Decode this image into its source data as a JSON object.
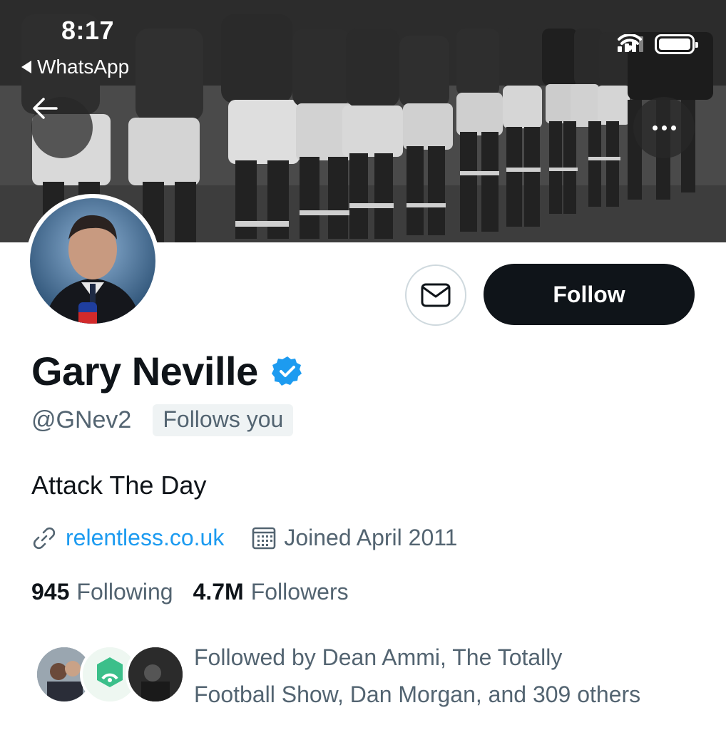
{
  "status_bar": {
    "time": "8:17",
    "back_app": "WhatsApp"
  },
  "header": {
    "back_icon": "arrow-left-icon",
    "more_icon": "more-horizontal-icon"
  },
  "profile": {
    "name": "Gary Neville",
    "verified": true,
    "handle": "@GNev2",
    "follows_you": "Follows you",
    "bio": "Attack The Day",
    "website": "relentless.co.uk",
    "joined": "Joined April 2011",
    "following_count": "945",
    "following_label": "Following",
    "followers_count": "4.7M",
    "followers_label": "Followers",
    "followed_by_line1": "Followed by Dean Ammi, The Totally",
    "followed_by_line2": "Football Show, Dan Morgan, and 309 others"
  },
  "actions": {
    "follow_label": "Follow",
    "message_icon": "envelope-icon"
  },
  "colors": {
    "accent": "#1d9bf0",
    "text_primary": "#0f1419",
    "text_secondary": "#536471",
    "follow_button": "#0f1419",
    "chip_bg": "#eff3f4"
  }
}
